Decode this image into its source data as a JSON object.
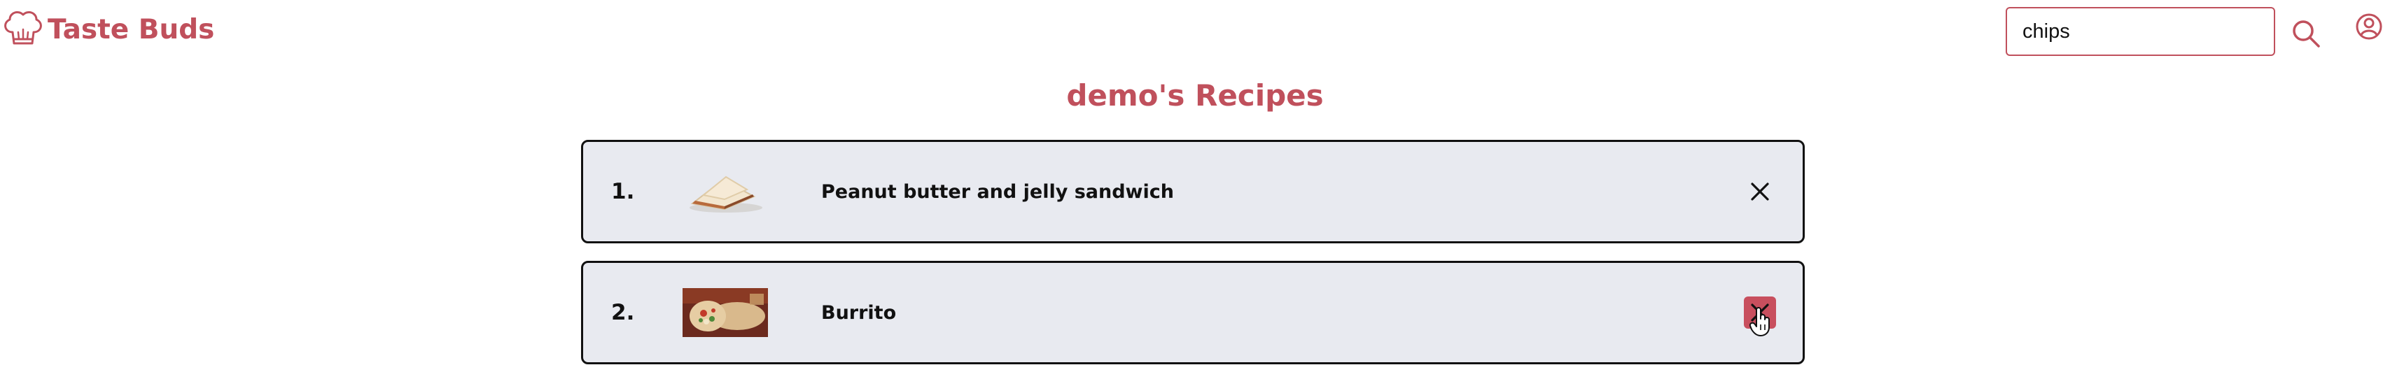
{
  "header": {
    "brand_name": "Taste Buds",
    "brand_icon": "chef-hat-icon",
    "search": {
      "value": "chips",
      "placeholder": ""
    },
    "search_icon": "search-icon",
    "profile_icon": "user-circle-icon"
  },
  "page": {
    "title": "demo's Recipes"
  },
  "recipes": [
    {
      "index": "1.",
      "name": "Peanut butter and jelly sandwich",
      "thumb_icon": "sandwich-photo",
      "remove_icon": "close-icon"
    },
    {
      "index": "2.",
      "name": "Burrito",
      "thumb_icon": "burrito-photo",
      "remove_icon": "close-icon"
    }
  ],
  "colors": {
    "brand": "#c0505c",
    "card_background": "#e8eaf0",
    "card_border": "#111111",
    "remove_hover": "#c84f5e"
  }
}
